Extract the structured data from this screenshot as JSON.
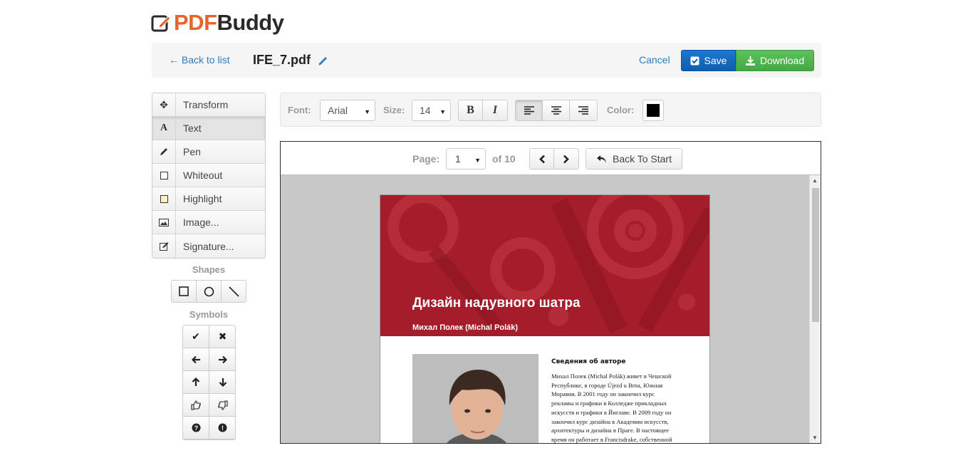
{
  "brand": {
    "pdf": "PDF",
    "buddy": "Buddy"
  },
  "topbar": {
    "back_label": "← Back to list",
    "filename": "IFE_7.pdf",
    "cancel_label": "Cancel",
    "save_label": "Save",
    "download_label": "Download"
  },
  "tools": [
    {
      "label": "Transform",
      "icon": "move-icon"
    },
    {
      "label": "Text",
      "icon": "text-icon",
      "active": true
    },
    {
      "label": "Pen",
      "icon": "pencil-icon"
    },
    {
      "label": "Whiteout",
      "icon": "whiteout-square-icon"
    },
    {
      "label": "Highlight",
      "icon": "highlight-square-icon"
    },
    {
      "label": "Image...",
      "icon": "image-icon"
    },
    {
      "label": "Signature...",
      "icon": "signature-icon"
    }
  ],
  "shapes": {
    "title": "Shapes",
    "items": [
      "rectangle-icon",
      "circle-icon",
      "line-icon"
    ]
  },
  "symbols": {
    "title": "Symbols",
    "items": [
      "check-icon",
      "cross-icon",
      "arrow-left-icon",
      "arrow-right-icon",
      "arrow-up-icon",
      "arrow-down-icon",
      "thumbs-up-icon",
      "thumbs-down-icon",
      "question-icon",
      "exclamation-icon"
    ]
  },
  "format": {
    "font_label": "Font:",
    "font_value": "Arial",
    "size_label": "Size:",
    "size_value": "14",
    "bold": "B",
    "italic": "I",
    "color_label": "Color:",
    "color_value": "#000000",
    "align_active": "left"
  },
  "pager": {
    "page_label": "Page:",
    "page_value": "1",
    "of_label": "of 10",
    "back_to_start": "Back To Start"
  },
  "pdf": {
    "banner_color": "#a51d2a",
    "title": "Дизайн надувного шатра",
    "author": "Михал Полек (Michal Polák)",
    "about_title": "Сведения об авторе",
    "about_lines": [
      "Михал Полек (Michal Polák) живет в Чешской",
      "Республике, в городе Újezd u Brna, Южная",
      "Моравия. В 2001 году он закончил курс",
      "рекламы и графики в Колледже прикладных",
      "искусств и графики в Йиглаве. В 2009 году он",
      "закончил курс дизайна в Академии искусств,",
      "архитектуры и дизайна в Праге. В настоящее",
      "время он работает в Francisdrake, собственной"
    ]
  }
}
